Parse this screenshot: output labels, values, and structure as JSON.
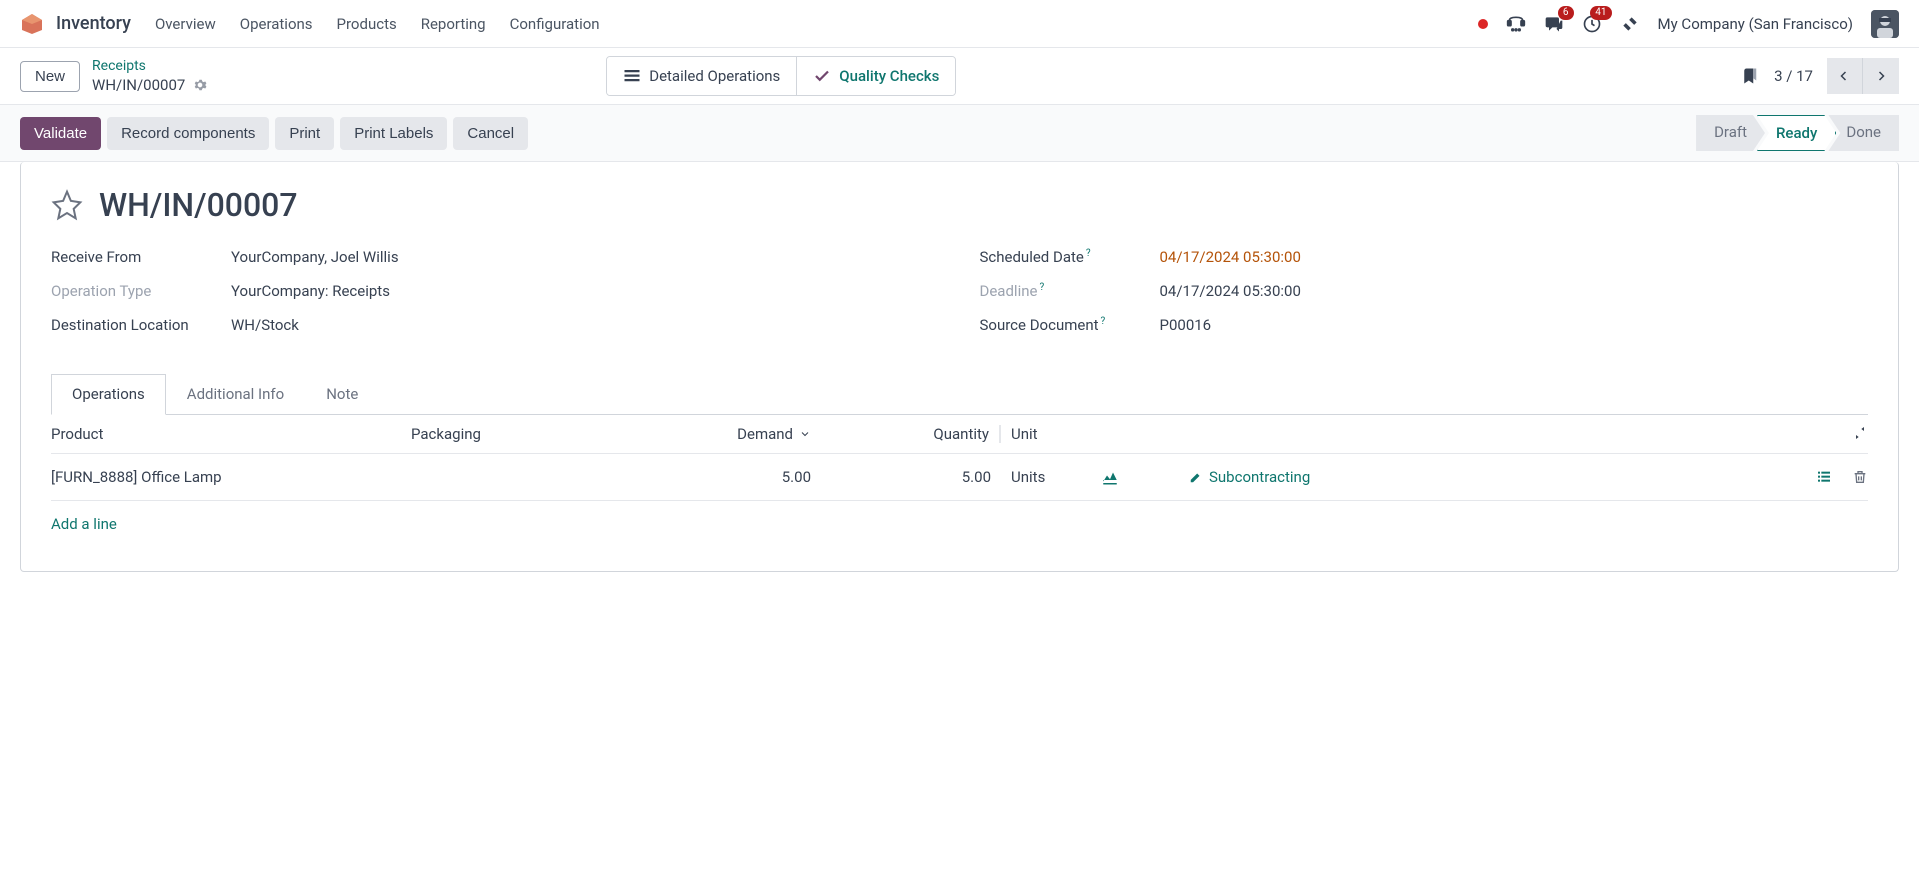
{
  "topbar": {
    "app_name": "Inventory",
    "nav": [
      "Overview",
      "Operations",
      "Products",
      "Reporting",
      "Configuration"
    ],
    "messages_badge": "6",
    "activities_badge": "41",
    "company": "My Company (San Francisco)"
  },
  "subheader": {
    "new_label": "New",
    "breadcrumb_parent": "Receipts",
    "breadcrumb_current": "WH/IN/00007",
    "detailed_ops": "Detailed Operations",
    "quality_checks": "Quality Checks",
    "pager": "3 / 17"
  },
  "actions": {
    "validate": "Validate",
    "record": "Record components",
    "print": "Print",
    "print_labels": "Print Labels",
    "cancel": "Cancel"
  },
  "status": {
    "draft": "Draft",
    "ready": "Ready",
    "done": "Done"
  },
  "form": {
    "title": "WH/IN/00007",
    "receive_from_label": "Receive From",
    "receive_from_value": "YourCompany, Joel Willis",
    "operation_type_label": "Operation Type",
    "operation_type_value": "YourCompany: Receipts",
    "destination_label": "Destination Location",
    "destination_value": "WH/Stock",
    "scheduled_label": "Scheduled Date",
    "scheduled_value": "04/17/2024 05:30:00",
    "deadline_label": "Deadline",
    "deadline_value": "04/17/2024 05:30:00",
    "source_label": "Source Document",
    "source_value": "P00016"
  },
  "tabs": {
    "operations": "Operations",
    "additional": "Additional Info",
    "note": "Note"
  },
  "table": {
    "headers": {
      "product": "Product",
      "packaging": "Packaging",
      "demand": "Demand",
      "quantity": "Quantity",
      "unit": "Unit"
    },
    "row": {
      "product": "[FURN_8888] Office Lamp",
      "demand": "5.00",
      "quantity": "5.00",
      "unit": "Units",
      "subcontracting": "Subcontracting"
    },
    "add_line": "Add a line"
  }
}
